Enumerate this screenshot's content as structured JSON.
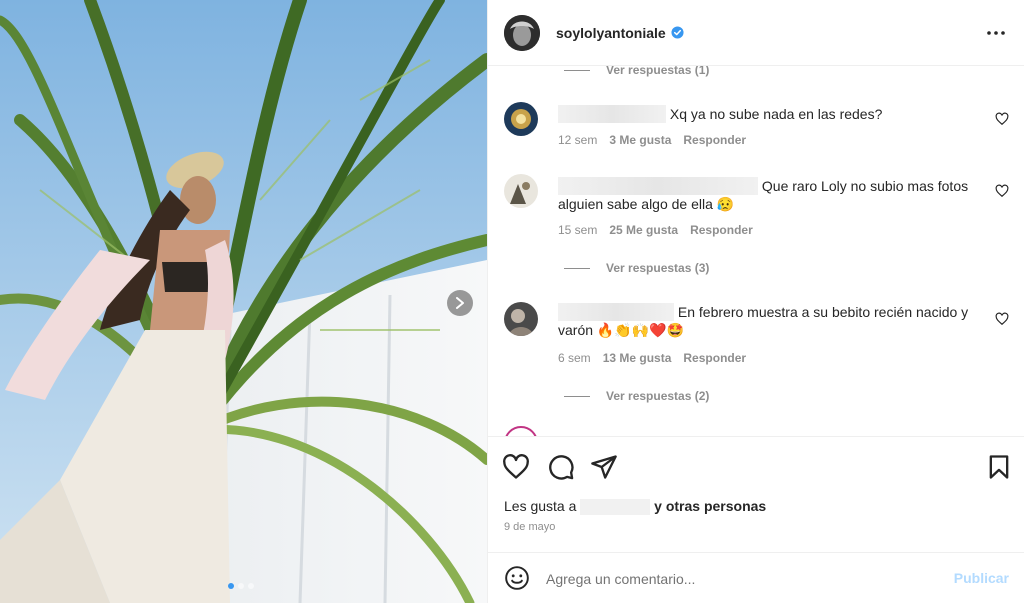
{
  "post": {
    "username": "soylolyantoniale",
    "verified": true,
    "carousel": {
      "total_slides": 3,
      "active_slide": 1
    }
  },
  "comments": {
    "first_view_replies": "Ver respuestas (1)",
    "items": [
      {
        "text": "Xq ya no sube nada en las redes?",
        "time": "12 sem",
        "likes": "3 Me gusta",
        "reply": "Responder"
      },
      {
        "text": "Que raro Loly no subio mas fotos alguien sabe algo de ella 😥",
        "time": "15 sem",
        "likes": "25 Me gusta",
        "reply": "Responder",
        "view_replies": "Ver respuestas (3)"
      },
      {
        "text": "En febrero muestra a su bebito recién nacido y varón 🔥👏🙌❤️🤩",
        "time": "6 sem",
        "likes": "13 Me gusta",
        "reply": "Responder",
        "view_replies": "Ver respuestas (2)"
      }
    ]
  },
  "footer": {
    "likes_prefix": "Les gusta a",
    "likes_suffix": "y otras personas",
    "date": "9 de mayo",
    "comment_placeholder": "Agrega un comentario...",
    "publish_label": "Publicar"
  }
}
